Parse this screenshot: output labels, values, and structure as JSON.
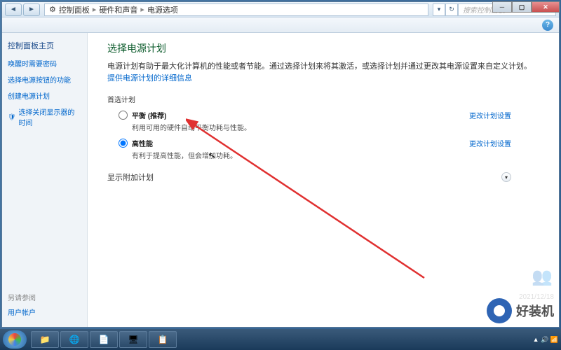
{
  "titlebar": {
    "breadcrumb": [
      "控制面板",
      "硬件和声音",
      "电源选项"
    ],
    "searchPlaceholder": "搜索控制面板"
  },
  "sidebar": {
    "home": "控制面板主页",
    "links": [
      "唤醒时需要密码",
      "选择电源按钮的功能",
      "创建电源计划",
      "选择关闭显示器的时间"
    ],
    "bottomHeader": "另请参阅",
    "bottomLink": "用户帐户"
  },
  "content": {
    "title": "选择电源计划",
    "desc1": "电源计划有助于最大化计算机的性能或者节能。通过选择计划来将其激活，或选择计划并通过更改其电源设置来自定义计划。",
    "descLink": "提供电源计划的详细信息",
    "preferredLabel": "首选计划",
    "plans": [
      {
        "name": "平衡 (推荐)",
        "desc": "利用可用的硬件自动平衡功耗与性能。",
        "link": "更改计划设置",
        "selected": false
      },
      {
        "name": "高性能",
        "desc": "有利于提高性能，但会增加功耗。",
        "link": "更改计划设置",
        "selected": true
      }
    ],
    "moreLabel": "显示附加计划"
  },
  "taskbar": {
    "items": [
      "📁",
      "🌐",
      "📄",
      "🖥",
      "📋"
    ]
  },
  "watermark": {
    "text": "好装机",
    "date": "2021/12/18"
  }
}
